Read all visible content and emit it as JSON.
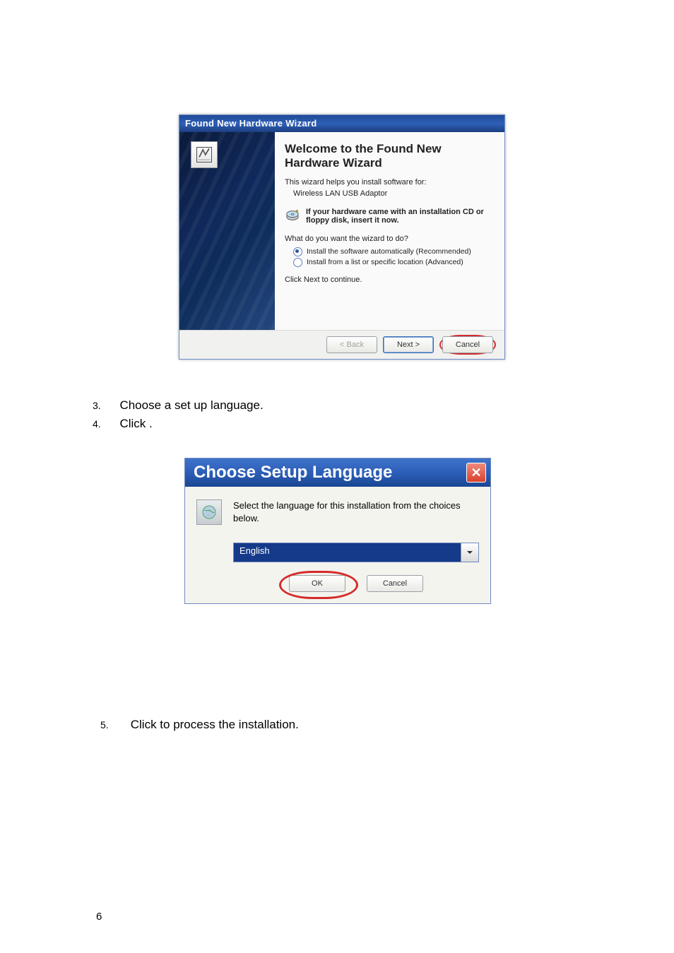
{
  "wizard": {
    "title": "Found New Hardware Wizard",
    "heading": "Welcome to the Found New Hardware Wizard",
    "intro": "This wizard helps you install software for:",
    "device": "Wireless  LAN USB Adaptor",
    "cd_hint": "If your hardware came with an installation CD or floppy disk, insert it now.",
    "question": "What do you want the wizard to do?",
    "opt1": "Install the software automatically (Recommended)",
    "opt2": "Install from a list or specific location (Advanced)",
    "continue": "Click Next to continue.",
    "back": "< Back",
    "next": "Next >",
    "cancel": "Cancel"
  },
  "steps": {
    "s3_num": "3.",
    "s3_txt": "Choose a set up language.",
    "s4_num": "4.",
    "s4_txt": "Click      .",
    "s5_num": "5.",
    "s5_txt": "Click         to process the installation."
  },
  "lang": {
    "title": "Choose Setup Language",
    "msg": "Select the language for this installation from the choices below.",
    "selected": "English",
    "ok": "OK",
    "cancel": "Cancel"
  },
  "page_number": "6"
}
